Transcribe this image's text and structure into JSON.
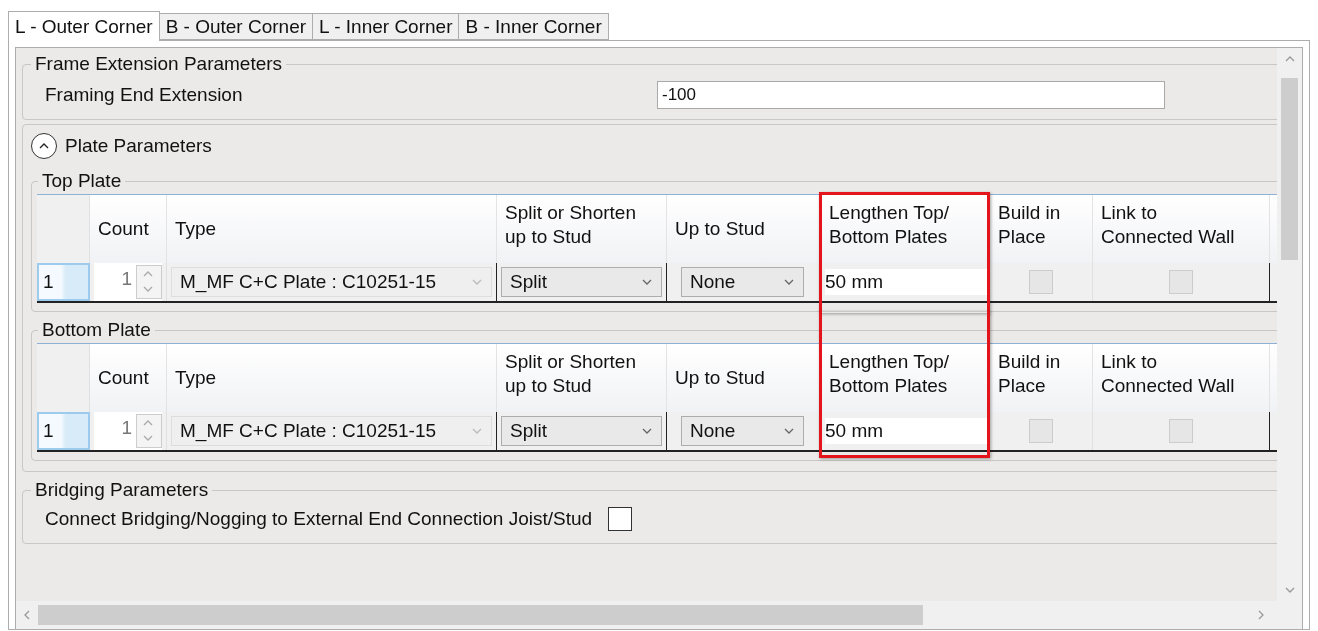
{
  "tabs": [
    {
      "label": "L - Outer Corner",
      "selected": true
    },
    {
      "label": "B - Outer Corner",
      "selected": false
    },
    {
      "label": "L - Inner Corner",
      "selected": false
    },
    {
      "label": "B - Inner Corner",
      "selected": false
    }
  ],
  "frame_extension": {
    "legend": "Frame Extension Parameters",
    "label": "Framing End Extension",
    "value": "-100"
  },
  "plate_parameters": {
    "title": "Plate Parameters",
    "expanded": true,
    "tables": [
      {
        "legend": "Top Plate",
        "columns": [
          {
            "label": "Count",
            "highlighted": false
          },
          {
            "label": "Type",
            "highlighted": false
          },
          {
            "label": "Split or Shorten up to Stud",
            "highlighted": false
          },
          {
            "label": "Up to Stud",
            "highlighted": false
          },
          {
            "label": "Lengthen Top/ Bottom Plates",
            "highlighted": true
          },
          {
            "label": "Build in Place",
            "highlighted": false
          },
          {
            "label": "Link to Connected Wall",
            "highlighted": false
          }
        ],
        "rows": [
          {
            "row_header": "1",
            "count": "1",
            "type": "M_MF C+C Plate : C10251-15",
            "split": "Split",
            "up_to_stud": "None",
            "lengthen": "50 mm",
            "build_in_place": false,
            "link_to_wall": false
          }
        ]
      },
      {
        "legend": "Bottom Plate",
        "columns": [
          {
            "label": "Count",
            "highlighted": false
          },
          {
            "label": "Type",
            "highlighted": false
          },
          {
            "label": "Split or Shorten up to Stud",
            "highlighted": false
          },
          {
            "label": "Up to Stud",
            "highlighted": false
          },
          {
            "label": "Lengthen Top/ Bottom Plates",
            "highlighted": true
          },
          {
            "label": "Build in Place",
            "highlighted": false
          },
          {
            "label": "Link to Connected Wall",
            "highlighted": false
          }
        ],
        "rows": [
          {
            "row_header": "1",
            "count": "1",
            "type": "M_MF C+C Plate : C10251-15",
            "split": "Split",
            "up_to_stud": "None",
            "lengthen": "50 mm",
            "build_in_place": false,
            "link_to_wall": false
          }
        ]
      }
    ]
  },
  "bridging": {
    "legend": "Bridging Parameters",
    "label": "Connect Bridging/Nogging to External End Connection Joist/Stud",
    "checked": false
  }
}
